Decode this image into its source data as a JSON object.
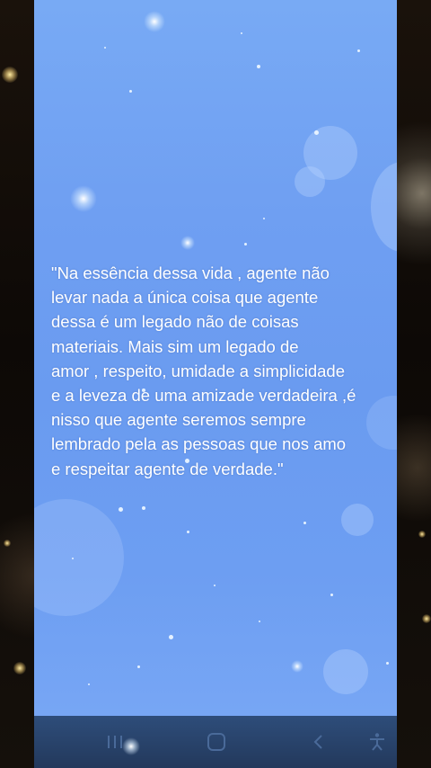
{
  "quote": {
    "lines": [
      "\"Na essência dessa vida , agente não",
      "levar nada a única coisa que agente",
      "dessa é  um legado não de coisas",
      "materiais. Mais sim um legado de",
      "amor , respeito, umidade a simplicidade",
      "e a leveza de uma amizade verdadeira ,é",
      "nisso que agente seremos sempre",
      "lembrado pela as pessoas que nos amo",
      "e respeitar agente de verdade.\""
    ]
  },
  "navbar": {
    "recent_icon": "recent-apps-icon",
    "home_icon": "home-icon",
    "back_icon": "back-icon",
    "accessibility_icon": "accessibility-icon",
    "icon_color": "#4a6a99"
  },
  "colors": {
    "panel": "#6f9ff2",
    "text": "#ffffff",
    "navbar": "#2a4470",
    "background": "#0d0906"
  }
}
